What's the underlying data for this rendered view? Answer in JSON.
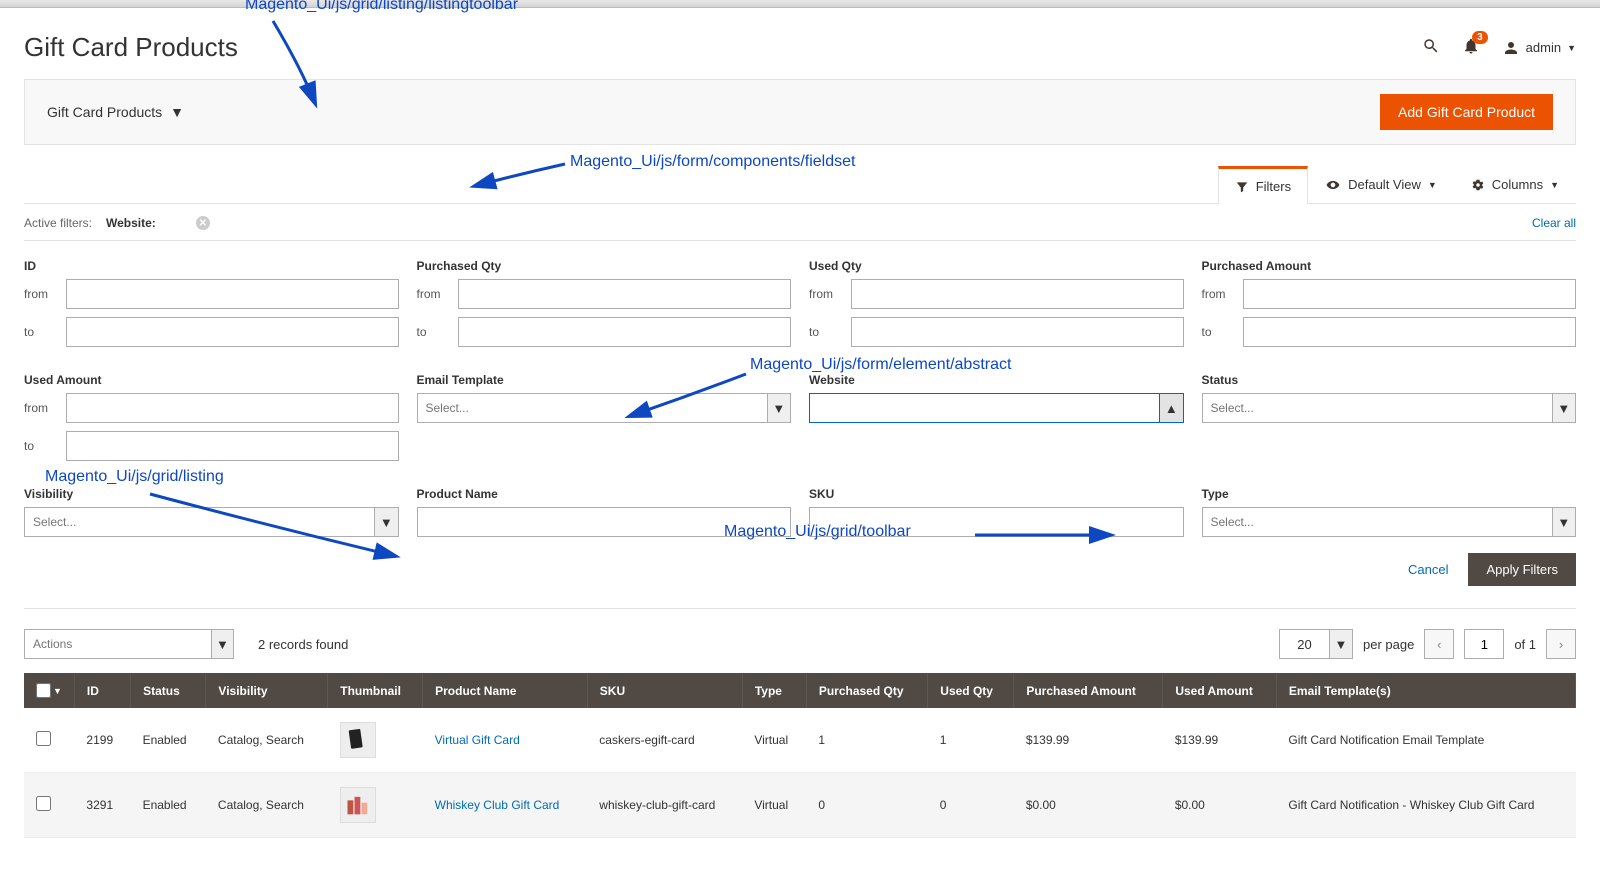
{
  "header": {
    "title": "Gift Card Products",
    "notification_count": "3",
    "admin_label": "admin"
  },
  "toolbar": {
    "dropdown_label": "Gift Card Products",
    "add_button": "Add Gift Card Product"
  },
  "grid_controls": {
    "filters": "Filters",
    "default_view": "Default View",
    "columns": "Columns"
  },
  "active_filters": {
    "label": "Active filters:",
    "chip": "Website:",
    "clear_all": "Clear all"
  },
  "filters": {
    "id": {
      "label": "ID",
      "from": "from",
      "to": "to"
    },
    "purchased_qty": {
      "label": "Purchased Qty",
      "from": "from",
      "to": "to"
    },
    "used_qty": {
      "label": "Used Qty",
      "from": "from",
      "to": "to"
    },
    "purchased_amount": {
      "label": "Purchased Amount",
      "from": "from",
      "to": "to"
    },
    "used_amount": {
      "label": "Used Amount",
      "from": "from",
      "to": "to"
    },
    "email_template": {
      "label": "Email Template",
      "placeholder": "Select..."
    },
    "website": {
      "label": "Website"
    },
    "status": {
      "label": "Status",
      "placeholder": "Select..."
    },
    "visibility": {
      "label": "Visibility",
      "placeholder": "Select..."
    },
    "product_name": {
      "label": "Product Name"
    },
    "sku": {
      "label": "SKU"
    },
    "type": {
      "label": "Type",
      "placeholder": "Select..."
    },
    "cancel": "Cancel",
    "apply": "Apply Filters"
  },
  "annotations": {
    "toolbar": "Magento_Ui/js/grid/listing/listingtoolbar",
    "fieldset": "Magento_Ui/js/form/components/fieldset",
    "abstract": "Magento_Ui/js/form/element/abstract",
    "listing": "Magento_Ui/js/grid/listing",
    "grid_toolbar": "Magento_Ui/js/grid/toolbar"
  },
  "records": {
    "actions": "Actions",
    "found": "2 records found",
    "per_page_value": "20",
    "per_page_label": "per page",
    "page_current": "1",
    "page_of": "of 1"
  },
  "columns": {
    "id": "ID",
    "status": "Status",
    "visibility": "Visibility",
    "thumbnail": "Thumbnail",
    "product_name": "Product Name",
    "sku": "SKU",
    "type": "Type",
    "purchased_qty": "Purchased Qty",
    "used_qty": "Used Qty",
    "purchased_amount": "Purchased Amount",
    "used_amount": "Used Amount",
    "email_templates": "Email Template(s)"
  },
  "rows": [
    {
      "id": "2199",
      "status": "Enabled",
      "visibility": "Catalog, Search",
      "name": "Virtual Gift Card",
      "sku": "caskers-egift-card",
      "type": "Virtual",
      "p_qty": "1",
      "u_qty": "1",
      "p_amt": "$139.99",
      "u_amt": "$139.99",
      "email": "Gift Card Notification Email Template"
    },
    {
      "id": "3291",
      "status": "Enabled",
      "visibility": "Catalog, Search",
      "name": "Whiskey Club Gift Card",
      "sku": "whiskey-club-gift-card",
      "type": "Virtual",
      "p_qty": "0",
      "u_qty": "0",
      "p_amt": "$0.00",
      "u_amt": "$0.00",
      "email": "Gift Card Notification - Whiskey Club Gift Card"
    }
  ]
}
